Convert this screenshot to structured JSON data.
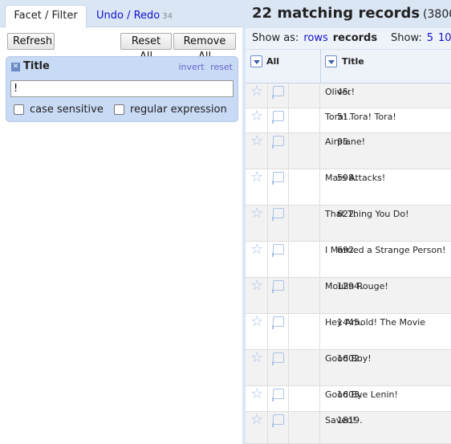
{
  "tabs": {
    "facet_filter": "Facet / Filter",
    "undo_redo": "Undo / Redo",
    "undo_count": "34"
  },
  "toolbar": {
    "refresh": "Refresh",
    "reset_all": "Reset All",
    "remove_all": "Remove All"
  },
  "facet": {
    "title": "Title",
    "invert": "invert",
    "reset": "reset",
    "input_value": "!",
    "case_sensitive": "case sensitive",
    "regular_expression": "regular expression"
  },
  "summary": {
    "main": "22 matching records",
    "total": "(3800 total)"
  },
  "viewbar": {
    "show_as": "Show as:",
    "rows": "rows",
    "records": "records",
    "show": "Show:",
    "n5": "5",
    "n10": "10"
  },
  "columns": {
    "all": "All",
    "title": "Title"
  },
  "records": [
    {
      "num": "45.",
      "title": "Oliver!"
    },
    {
      "num": "51.",
      "title": "Tora! Tora! Tora!"
    },
    {
      "num": "95.",
      "title": "Airplane!"
    },
    {
      "num": "598.",
      "title": "Mars Attacks!"
    },
    {
      "num": "622.",
      "title": "That Thing You Do!"
    },
    {
      "num": "692.",
      "title": "I Married a Strange Person!"
    },
    {
      "num": "1294.",
      "title": "Moulin Rouge!"
    },
    {
      "num": "1445.",
      "title": "Hey Arnold! The Movie"
    },
    {
      "num": "1602.",
      "title": "Good Boy!"
    },
    {
      "num": "1603.",
      "title": "Good Bye Lenin!"
    },
    {
      "num": "1819.",
      "title": "Saved!"
    }
  ]
}
